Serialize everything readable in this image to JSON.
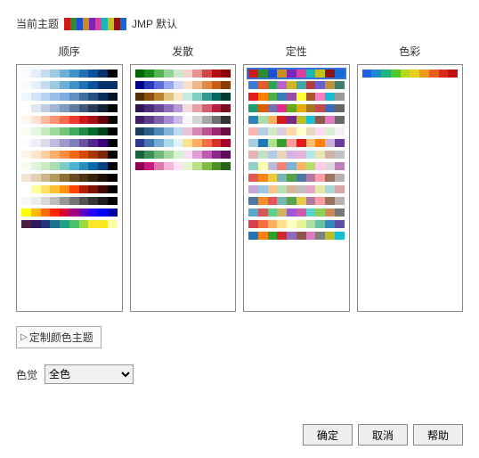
{
  "header": {
    "label": "当前主题",
    "name": "JMP 默认",
    "swatch": [
      "#d11919",
      "#308a30",
      "#1f4fd6",
      "#c98e15",
      "#7c25b8",
      "#e03fa1",
      "#18b6b6",
      "#c4c21a",
      "#8c1414",
      "#1569d6"
    ]
  },
  "columns": [
    {
      "id": "sequential",
      "title": "顺序",
      "rows": [
        [
          "#f7fbff",
          "#e3f0fa",
          "#c6dbef",
          "#9ecae1",
          "#6baed6",
          "#4292c6",
          "#2171b5",
          "#08519c",
          "#08306b",
          "#000000"
        ],
        [
          "#f7fbff",
          "#e3f0fa",
          "#c6dbef",
          "#9ecae1",
          "#6baed6",
          "#4292c6",
          "#2171b5",
          "#08519c",
          "#08306b",
          "#08306b"
        ],
        [
          "#f0f5fc",
          "#d4e3f6",
          "#b7d1f0",
          "#9abfea",
          "#7eade4",
          "#5c90c4",
          "#3f6fa1",
          "#244f7e",
          "#0a2f5b",
          "#031629"
        ],
        [
          "#ffffff",
          "#e0e6f0",
          "#c0cde0",
          "#a0b4d0",
          "#809bc0",
          "#5f7ba0",
          "#40567a",
          "#283a55",
          "#152236",
          "#000000"
        ],
        [
          "#fff5f0",
          "#fee0d2",
          "#fcbba1",
          "#fc9272",
          "#fb6a4a",
          "#ef3b2c",
          "#cb181d",
          "#a50f15",
          "#67000d",
          "#000000"
        ],
        [
          "#f7fcf5",
          "#e5f5e0",
          "#c7e9c0",
          "#a1d99b",
          "#74c476",
          "#41ab5d",
          "#238b45",
          "#006d2c",
          "#00441b",
          "#000000"
        ],
        [
          "#fcfbfd",
          "#efedf5",
          "#dadaeb",
          "#bcbddc",
          "#9e9ac8",
          "#807dba",
          "#6a51a3",
          "#54278f",
          "#3f007d",
          "#000000"
        ],
        [
          "#fff5eb",
          "#fee6ce",
          "#fdd0a2",
          "#fdae6b",
          "#fd8d3c",
          "#f16913",
          "#d94801",
          "#a63603",
          "#7f2704",
          "#000000"
        ],
        [
          "#f7fcf0",
          "#e0f3db",
          "#ccebc5",
          "#a8ddb5",
          "#7bccc4",
          "#4eb3d3",
          "#2b8cbe",
          "#0868ac",
          "#084081",
          "#000000"
        ],
        [
          "#efe5d4",
          "#e1d2b4",
          "#cbb68a",
          "#b59a60",
          "#8f6d34",
          "#6a4a1e",
          "#4c3515",
          "#33230d",
          "#1a1206",
          "#000000"
        ],
        [
          "#ffffff",
          "#ffff99",
          "#ffe066",
          "#ffc030",
          "#ff9010",
          "#ff4000",
          "#b02000",
          "#801000",
          "#400800",
          "#000000"
        ],
        [
          "#f7f7f7",
          "#ededed",
          "#d9d9d9",
          "#bdbdbd",
          "#969696",
          "#737373",
          "#525252",
          "#363636",
          "#1d1d1d",
          "#000000"
        ],
        [
          "#ffff00",
          "#ffb800",
          "#ff6e00",
          "#ff2300",
          "#d80034",
          "#a1007f",
          "#5d00c6",
          "#2000ff",
          "#0000ff",
          "#0000aa"
        ],
        [
          "#4a1f40",
          "#2d1a5c",
          "#25347a",
          "#1b6e8c",
          "#1fa187",
          "#4ac16d",
          "#a0da39",
          "#fde725",
          "#f9e721",
          "#fcffa4"
        ]
      ]
    },
    {
      "id": "diverging",
      "title": "发散",
      "rows": [
        [
          "#006400",
          "#1b8a1b",
          "#52b452",
          "#94d194",
          "#cfe8cf",
          "#f4d2d2",
          "#e99090",
          "#d04545",
          "#b30f0f",
          "#8b0000"
        ],
        [
          "#00008b",
          "#2838b6",
          "#5a6dda",
          "#97a5ed",
          "#d2d9f6",
          "#f7e0cd",
          "#efb88a",
          "#e28a44",
          "#c85c10",
          "#8b3a00"
        ],
        [
          "#543005",
          "#8c510a",
          "#bf812d",
          "#dfc27d",
          "#f6e8c3",
          "#c7eae5",
          "#80cdc1",
          "#35978f",
          "#01665e",
          "#003c30"
        ],
        [
          "#2f1554",
          "#4c2a7a",
          "#6a4799",
          "#8d6dba",
          "#b49bd6",
          "#f4dcdc",
          "#e6a0a8",
          "#d25e6e",
          "#b5203a",
          "#7a0c20"
        ],
        [
          "#3f1c63",
          "#5d3a88",
          "#7e5fab",
          "#a38bd0",
          "#c9baea",
          "#f6f6f6",
          "#d4d4d4",
          "#a6a6a6",
          "#707070",
          "#333333"
        ],
        [
          "#1a3d5c",
          "#2d5f86",
          "#4c89b6",
          "#7fb3d7",
          "#bcd9ee",
          "#e7c5d9",
          "#d589b4",
          "#bb5390",
          "#9a2a6d",
          "#6a0d44"
        ],
        [
          "#313695",
          "#4575b4",
          "#74add1",
          "#abd9e9",
          "#e0f3f8",
          "#fee090",
          "#fdae61",
          "#f46d43",
          "#d73027",
          "#a50026"
        ],
        [
          "#18633b",
          "#3c9055",
          "#6eb97a",
          "#a4daa0",
          "#d7f2d2",
          "#f5e1ef",
          "#df9dd4",
          "#be59b2",
          "#8e278a",
          "#5c0c59"
        ],
        [
          "#8e0152",
          "#c51b7d",
          "#de77ae",
          "#f1b6da",
          "#fde0ef",
          "#e6f5d0",
          "#b8e186",
          "#7fbc41",
          "#4d9221",
          "#276419"
        ]
      ]
    },
    {
      "id": "qualitative",
      "title": "定性",
      "selected": 0,
      "rows": [
        [
          "#d11919",
          "#308a30",
          "#1f4fd6",
          "#c98e15",
          "#7c25b8",
          "#e03fa1",
          "#18b6b6",
          "#c4c21a",
          "#8c1414",
          "#1569d6"
        ],
        [
          "#3a7bd5",
          "#e35b2b",
          "#2fa355",
          "#b85fcf",
          "#d1b62a",
          "#3fa8a8",
          "#b53b3b",
          "#6a5fcf",
          "#c58f3a",
          "#3f7f6a"
        ],
        [
          "#e41a1c",
          "#ff7f00",
          "#4daf4a",
          "#377eb8",
          "#984ea3",
          "#ffff33",
          "#a65628",
          "#f781bf",
          "#17becf",
          "#999999"
        ],
        [
          "#1b9e77",
          "#d95f02",
          "#7570b3",
          "#e7298a",
          "#66a61e",
          "#e6ab02",
          "#a6761d",
          "#c24c4c",
          "#3a6abf",
          "#666666"
        ],
        [
          "#2b83ba",
          "#abdda4",
          "#fdae61",
          "#d7191c",
          "#762a83",
          "#bcbd22",
          "#17becf",
          "#8c564b",
          "#e377c2",
          "#686868"
        ],
        [
          "#fbb4ae",
          "#b3cde3",
          "#ccebc5",
          "#decbe4",
          "#fed9a6",
          "#ffffcc",
          "#e5d8bd",
          "#fddaec",
          "#d9f0d3",
          "#f2f2f2"
        ],
        [
          "#a6cee3",
          "#1f78b4",
          "#b2df8a",
          "#33a02c",
          "#fb9a99",
          "#e31a1c",
          "#fdbf6f",
          "#ff7f00",
          "#cab2d6",
          "#6a3d9a"
        ],
        [
          "#e6b3b3",
          "#c2e0c2",
          "#b3c9e6",
          "#e6d4b3",
          "#d4b3e6",
          "#e6b3d9",
          "#b3e6e6",
          "#e6e6b3",
          "#d0b3a5",
          "#c2c2c2"
        ],
        [
          "#8dd3c7",
          "#ffffb3",
          "#bebada",
          "#fb8072",
          "#80b1d3",
          "#fdb462",
          "#b3de69",
          "#fccde5",
          "#d9d9d9",
          "#bc80bd"
        ],
        [
          "#e45756",
          "#f58518",
          "#eeca3b",
          "#72b7b2",
          "#54a24b",
          "#4c78a8",
          "#b279a2",
          "#ff9da6",
          "#9d755d",
          "#bab0ac"
        ],
        [
          "#c7a5d9",
          "#9dc6e0",
          "#f5c38a",
          "#b4e0b4",
          "#d6b798",
          "#bfbfbf",
          "#e6a6c5",
          "#e6e6a6",
          "#a6d9d9",
          "#d9a6a6"
        ],
        [
          "#4e79a7",
          "#f28e2b",
          "#e15759",
          "#76b7b2",
          "#59a14f",
          "#edc948",
          "#b07aa1",
          "#ff9da7",
          "#9c755f",
          "#bab0ac"
        ],
        [
          "#5aa7d0",
          "#d05a5a",
          "#5ad08a",
          "#d0b35a",
          "#9e5ad0",
          "#d05aac",
          "#5ad0d0",
          "#8ad05a",
          "#d08a5a",
          "#787878"
        ],
        [
          "#d53e4f",
          "#f46d43",
          "#fdae61",
          "#fee08b",
          "#ffffbf",
          "#e6f598",
          "#abdda4",
          "#66c2a5",
          "#3288bd",
          "#5e4fa2"
        ],
        [
          "#1f77b4",
          "#ff7f0e",
          "#2ca02c",
          "#d62728",
          "#9467bd",
          "#8c564b",
          "#e377c2",
          "#7f7f7f",
          "#bcbd22",
          "#17becf"
        ]
      ]
    },
    {
      "id": "chromatic",
      "title": "色彩",
      "rows": [
        [
          "#2060e0",
          "#1e8ad0",
          "#1fb37e",
          "#4bc92f",
          "#b5d820",
          "#e6d01f",
          "#e89a1c",
          "#e6601a",
          "#dc2a1a",
          "#c01010"
        ]
      ]
    }
  ],
  "disclosure": {
    "label": "定制颜色主题"
  },
  "dropdown": {
    "label": "色觉",
    "value": "全色"
  },
  "buttons": {
    "ok": "确定",
    "cancel": "取消",
    "help": "帮助"
  }
}
